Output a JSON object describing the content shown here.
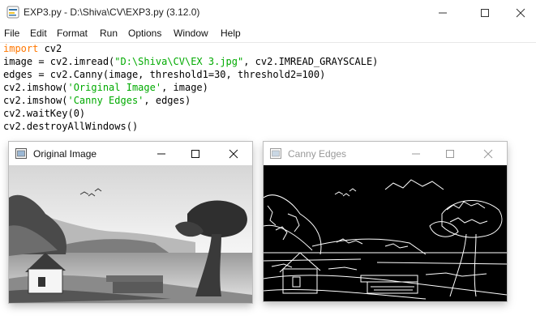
{
  "window": {
    "title": "EXP3.py - D:\\Shiva\\CV\\EXP3.py (3.12.0)",
    "controls": [
      "minimize",
      "maximize",
      "close"
    ]
  },
  "menu": [
    "File",
    "Edit",
    "Format",
    "Run",
    "Options",
    "Window",
    "Help"
  ],
  "code": [
    {
      "a": "import",
      "b": " cv2",
      "c": "",
      "d": ""
    },
    {
      "a": "image = cv2.imread(",
      "b": "\"D:\\Shiva\\CV\\EX 3.jpg\"",
      "c": ", cv2.IMREAD_GRAYSCALE)",
      "d": ""
    },
    {
      "a": "edges = cv2.Canny(image, threshold1=30, threshold2=100)",
      "b": "",
      "c": "",
      "d": ""
    },
    {
      "a": "cv2.imshow(",
      "b": "'Original Image'",
      "c": ", image)",
      "d": ""
    },
    {
      "a": "cv2.imshow(",
      "b": "'Canny Edges'",
      "c": ", edges)",
      "d": ""
    },
    {
      "a": "cv2.waitKey(0)",
      "b": "",
      "c": "",
      "d": ""
    },
    {
      "a": "cv2.destroyAllWindows()",
      "b": "",
      "c": "",
      "d": ""
    }
  ],
  "windows": {
    "original": {
      "title": "Original Image",
      "active": true
    },
    "canny": {
      "title": "Canny Edges",
      "active": false
    }
  },
  "colors": {
    "keyword": "#ff7700",
    "string": "#00aa00",
    "inactive_title": "#999999"
  }
}
